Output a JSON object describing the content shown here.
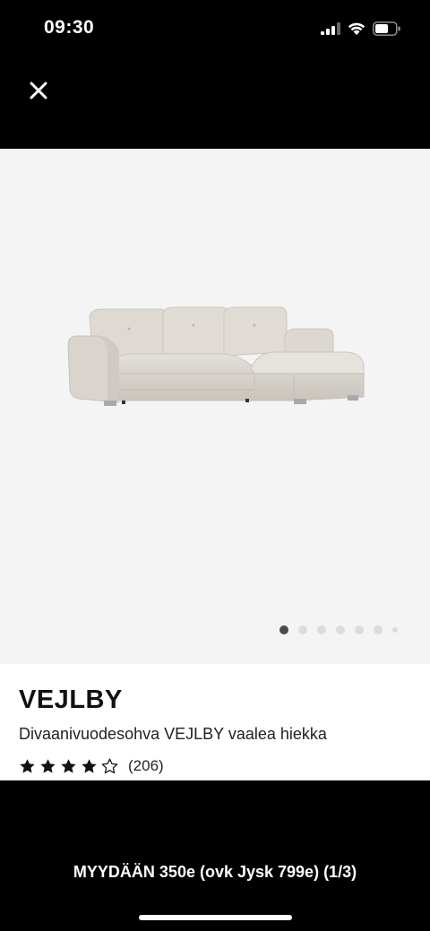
{
  "status_bar": {
    "time": "09:30",
    "icons": [
      "signal-icon",
      "wifi-icon",
      "battery-icon"
    ]
  },
  "header": {
    "close_icon": "close-icon"
  },
  "gallery": {
    "total_slides": 7,
    "active_slide": 1,
    "background": "#f4f4f4"
  },
  "product": {
    "name": "VEJLBY",
    "description": "Divaanivuodesohva VEJLBY vaalea hiekka",
    "rating": {
      "stars": 4,
      "max": 5,
      "count": "(206)"
    }
  },
  "caption": "MYYDÄÄN 350e (ovk Jysk 799e) (1/3)",
  "colors": {
    "background": "#000000",
    "info_panel": "#ffffff",
    "active_dot": "#4a4a4a",
    "inactive_dot": "#dcdcdc"
  }
}
